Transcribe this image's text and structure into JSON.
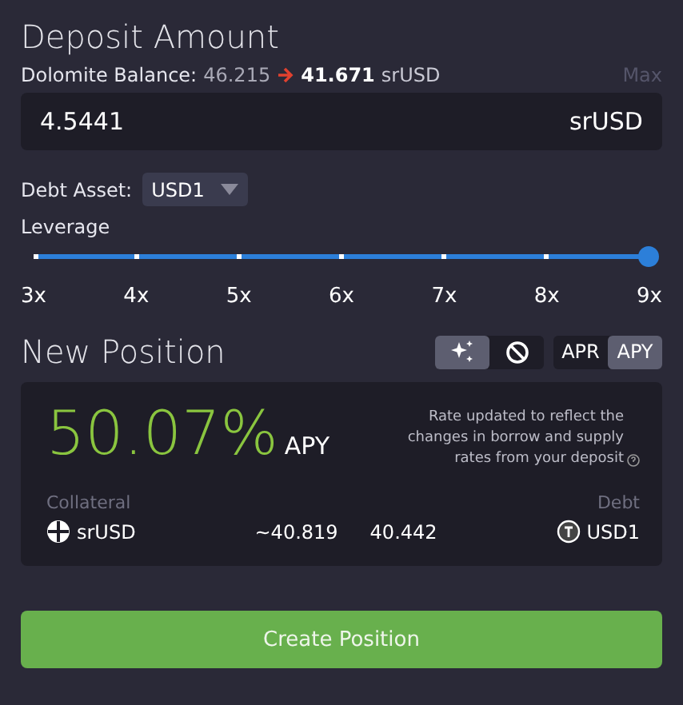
{
  "deposit": {
    "title": "Deposit Amount",
    "balance_label": "Dolomite Balance:",
    "balance_from": "46.215",
    "balance_to": "41.671",
    "balance_unit": "srUSD",
    "max": "Max",
    "value": "4.5441",
    "unit": "srUSD"
  },
  "debt_asset": {
    "label": "Debt Asset:",
    "value": "USD1"
  },
  "leverage": {
    "label": "Leverage",
    "level": 1,
    "ticks": [
      "3x",
      "4x",
      "5x",
      "6x",
      "7x",
      "8x",
      "9x"
    ]
  },
  "position": {
    "title": "New Position",
    "icon_toggles": [
      {
        "kind": "sparkle",
        "selected": true
      },
      {
        "kind": "ban",
        "selected": false
      }
    ],
    "rate_toggles": [
      {
        "label": "APR",
        "selected": false
      },
      {
        "label": "APY",
        "selected": true
      }
    ],
    "rate": "50.07%",
    "rate_unit": "APY",
    "note": "Rate updated to reflect the changes in borrow and supply rates from your deposit",
    "collateral_label": "Collateral",
    "debt_label": "Debt",
    "collateral_asset": "srUSD",
    "collateral_amount": "~40.819",
    "debt_amount": "40.442",
    "debt_asset": "USD1"
  },
  "button": "Create Position"
}
